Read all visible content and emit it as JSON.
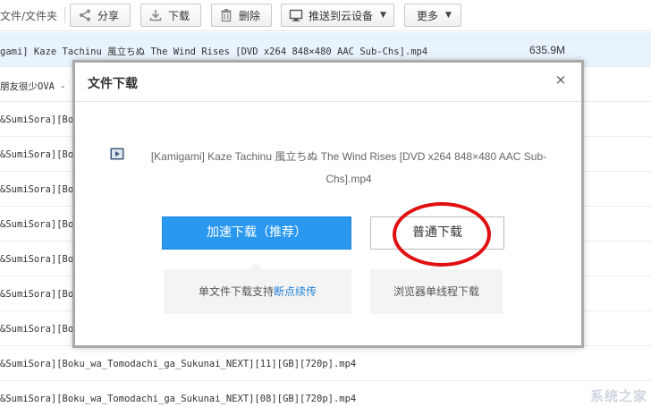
{
  "toolbar": {
    "breadcrumb": "文件/文件夹",
    "share": "分享",
    "download": "下载",
    "delete": "删除",
    "push_to_cloud": "推送到云设备",
    "more": "更多"
  },
  "files": [
    {
      "name": "gami] Kaze Tachinu 風立ちぬ The Wind Rises [DVD x264 848×480 AAC Sub-Chs].mp4",
      "size": "635.9M",
      "selected": true
    },
    {
      "name": "朋友很少OVA -",
      "size": ""
    },
    {
      "name": "&SumiSora][Bo",
      "size": ""
    },
    {
      "name": "&SumiSora][Bo",
      "size": ""
    },
    {
      "name": "&SumiSora][Bo",
      "size": ""
    },
    {
      "name": "&SumiSora][Bo",
      "size": ""
    },
    {
      "name": "&SumiSora][Bo",
      "size": ""
    },
    {
      "name": "&SumiSora][Bo",
      "size": ""
    },
    {
      "name": "&SumiSora][Bo",
      "size": ""
    },
    {
      "name": "&SumiSora][Boku_wa_Tomodachi_ga_Sukunai_NEXT][11][GB][720p].mp4",
      "size": ""
    },
    {
      "name": "&SumiSora][Boku_wa_Tomodachi_ga_Sukunai_NEXT][08][GB][720p].mp4",
      "size": ""
    }
  ],
  "dialog": {
    "title": "文件下载",
    "close": "×",
    "file_name": "[Kamigami] Kaze Tachinu 風立ちぬ The Wind Rises [DVD x264 848×480 AAC Sub-Chs].mp4",
    "fast_button": "加速下载（推荐）",
    "normal_button": "普通下载",
    "fast_tip_prefix": "单文件下载支持",
    "fast_tip_highlight": "断点续传",
    "normal_tip": "浏览器单线程下载"
  },
  "watermark": "系统之家",
  "colors": {
    "primary_button": "#2b98f0",
    "annotation_circle": "#e01010",
    "link_highlight": "#1f7fd6"
  },
  "icons": [
    "share-icon",
    "download-icon",
    "trash-icon",
    "cloud-push-icon",
    "video-file-icon",
    "close-icon"
  ]
}
